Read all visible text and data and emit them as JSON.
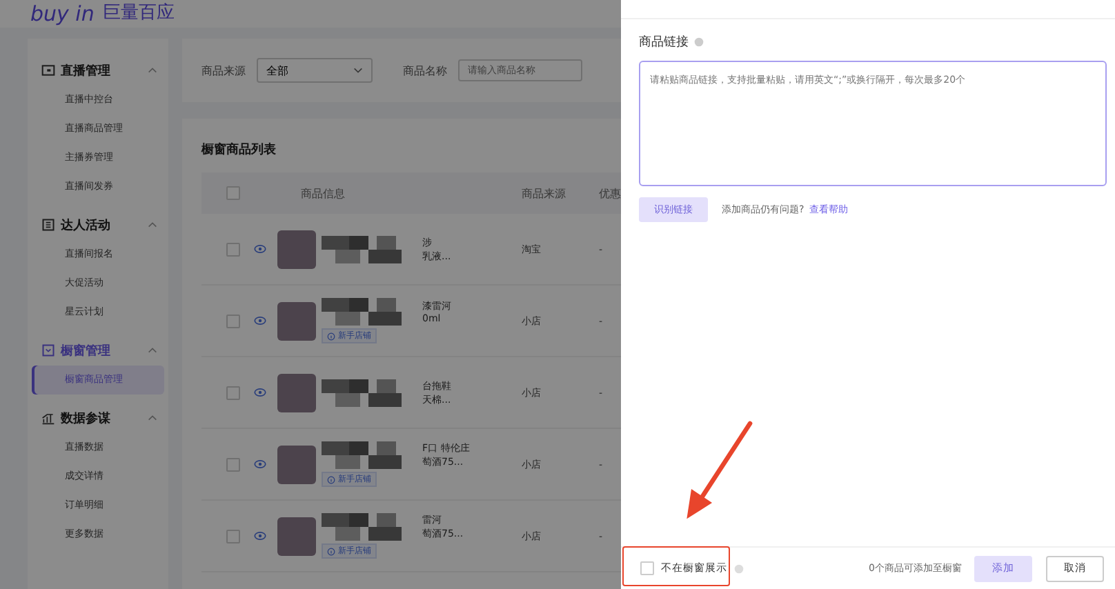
{
  "header": {
    "logo_latin": "buy in",
    "logo_cjk": "巨量百应"
  },
  "sidebar": {
    "groups": [
      {
        "title": "直播管理",
        "expanded": true,
        "items": [
          {
            "label": "直播中控台",
            "selected": false
          },
          {
            "label": "直播商品管理",
            "selected": false
          },
          {
            "label": "主播券管理",
            "selected": false
          },
          {
            "label": "直播间发券",
            "selected": false
          }
        ]
      },
      {
        "title": "达人活动",
        "expanded": true,
        "items": [
          {
            "label": "直播间报名",
            "selected": false
          },
          {
            "label": "大促活动",
            "selected": false
          },
          {
            "label": "星云计划",
            "selected": false
          }
        ]
      },
      {
        "title": "橱窗管理",
        "expanded": true,
        "items": [
          {
            "label": "橱窗商品管理",
            "selected": true
          }
        ]
      },
      {
        "title": "数据参谋",
        "expanded": true,
        "items": [
          {
            "label": "直播数据",
            "selected": false
          },
          {
            "label": "成交详情",
            "selected": false
          },
          {
            "label": "订单明细",
            "selected": false
          },
          {
            "label": "更多数据",
            "selected": false
          }
        ]
      }
    ]
  },
  "filters": [
    {
      "label": "商品来源",
      "kind": "select",
      "value": "全部"
    },
    {
      "label": "商品名称",
      "kind": "input",
      "placeholder": "请输入商品名称"
    }
  ],
  "table": {
    "title": "橱窗商品列表",
    "all_checked": false,
    "columns": [
      "商品信息",
      "商品来源",
      "优惠"
    ],
    "rows": [
      {
        "checked": false,
        "name_line_1": "涉",
        "name_line_2": "乳液...",
        "source": "淘宝",
        "column_3": "-"
      },
      {
        "checked": false,
        "name_line_1": "漆雷河",
        "name_line_2": "0ml",
        "source": "小店",
        "column_3": "-",
        "badge": "新手店铺"
      },
      {
        "checked": false,
        "name_line_1": "台拖鞋",
        "name_line_2": "天棉...",
        "source": "小店",
        "column_3": "-"
      },
      {
        "checked": false,
        "name_line_1": "F口 特伦庄",
        "name_line_2": "萄酒75...",
        "source": "小店",
        "column_3": "-",
        "badge": "新手店铺"
      },
      {
        "checked": false,
        "name_line_1": "雷河",
        "name_line_2": "萄酒75...",
        "source": "小店",
        "column_3": "-",
        "badge": "新手店铺"
      }
    ]
  },
  "drawer": {
    "field_label": "商品链接",
    "textarea_placeholder": "请粘贴商品链接，支持批量粘贴，请用英文“;”或换行隔开，每次最多20个",
    "parse_button": {
      "label": "识别链接",
      "disabled": true
    },
    "help_text": "添加商品仍有问题?",
    "help_link": "查看帮助",
    "footer": {
      "checkbox": {
        "label": "不在橱窗展示",
        "checked": false
      },
      "count_text": "0个商品可添加至橱窗",
      "buttons": [
        {
          "label": "添加",
          "kind": "primary",
          "disabled": true
        },
        {
          "label": "取消",
          "kind": "default",
          "disabled": false
        }
      ]
    }
  }
}
